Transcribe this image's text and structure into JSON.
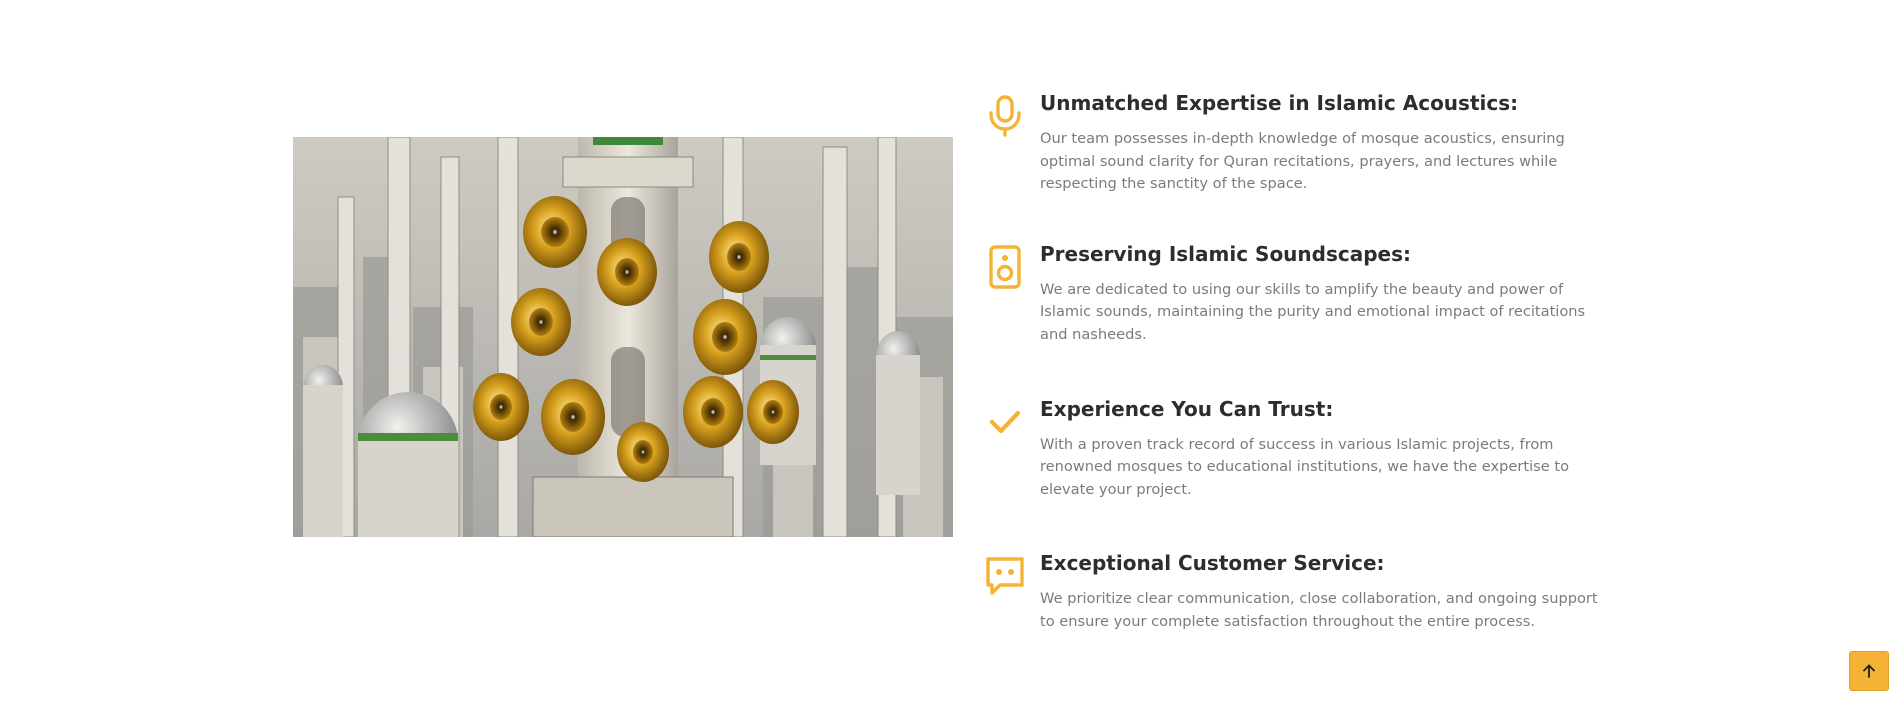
{
  "image": {
    "icon": "mosque-loudspeakers-image"
  },
  "features": [
    {
      "icon": "microphone-icon",
      "title": "Unmatched Expertise in Islamic Acoustics:",
      "text": "Our team possesses in-depth knowledge of mosque acoustics, ensuring optimal sound clarity for Quran recitations, prayers, and lectures while respecting the sanctity of the space."
    },
    {
      "icon": "speaker-icon",
      "title": "Preserving Islamic Soundscapes:",
      "text": "We are dedicated to using our skills to amplify the beauty and power of Islamic sounds, maintaining the purity and emotional impact of recitations and nasheeds."
    },
    {
      "icon": "check-icon",
      "title": "Experience You Can Trust:",
      "text": "With a proven track record of success in various Islamic projects, from renowned mosques to educational institutions, we have the expertise to elevate your project."
    },
    {
      "icon": "chat-icon",
      "title": "Exceptional Customer Service:",
      "text": "We prioritize clear communication, close collaboration, and ongoing support to ensure your complete satisfaction throughout the entire process."
    }
  ],
  "colors": {
    "accent": "#f5b335",
    "title": "#2d2d2d",
    "text": "#7b7b7b"
  },
  "back_to_top": {
    "icon": "arrow-up-icon"
  }
}
